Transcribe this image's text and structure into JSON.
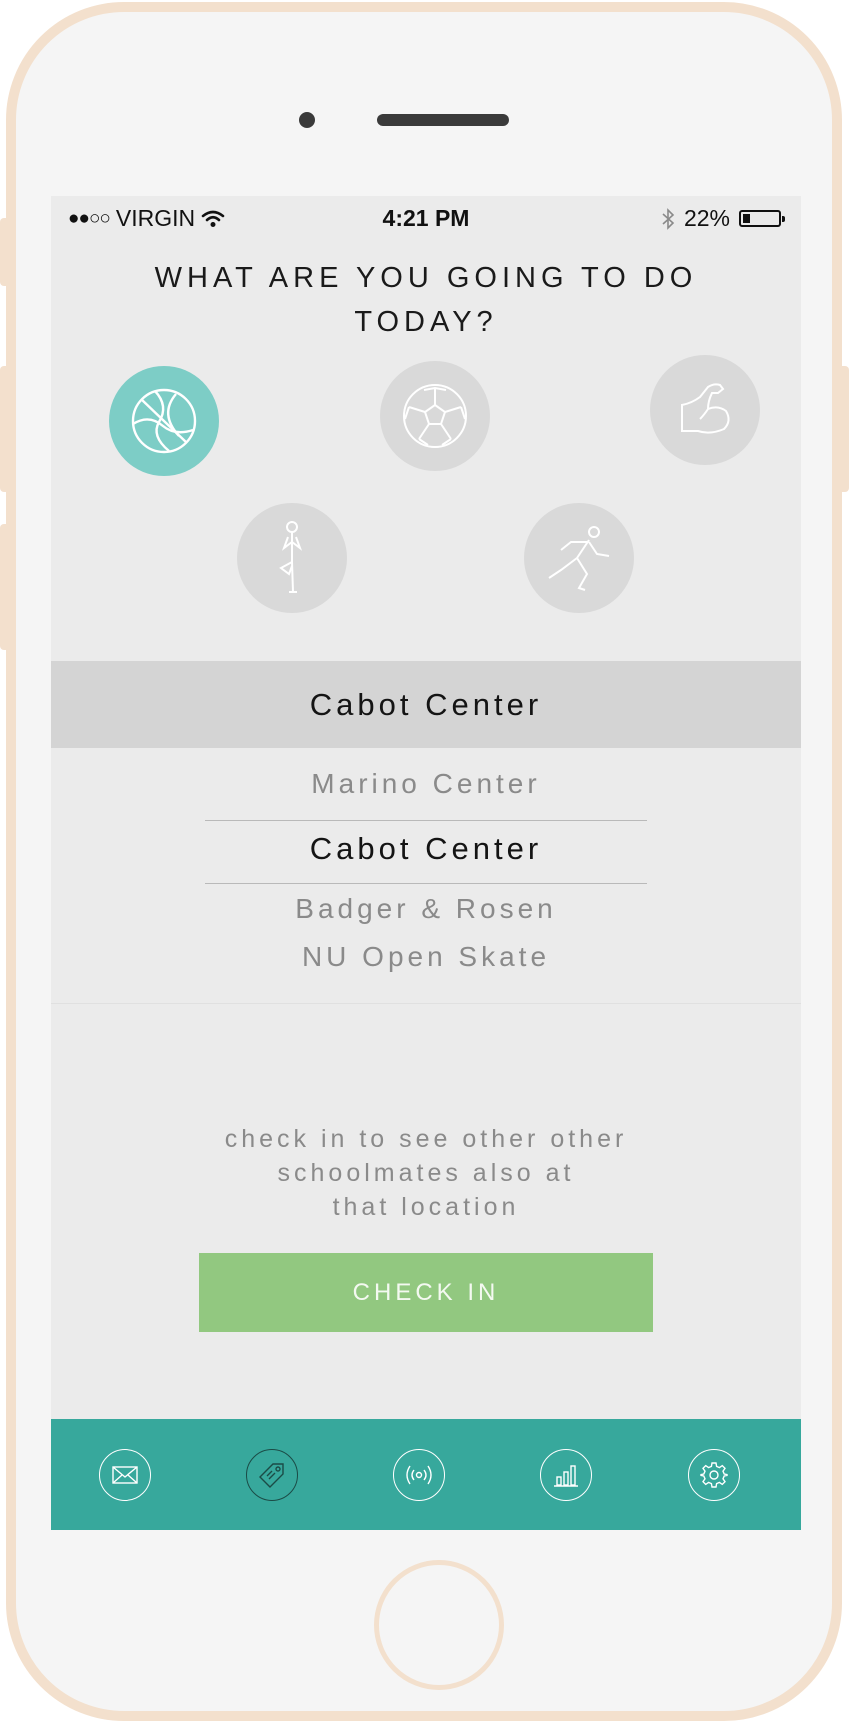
{
  "status_bar": {
    "signal": "●●○○",
    "carrier": "VIRGIN",
    "time": "4:21 PM",
    "battery_percent": "22%",
    "battery_level": 0.22
  },
  "question": {
    "line1": "WHAT ARE YOU GOING TO DO",
    "line2": "TODAY?"
  },
  "activities": [
    {
      "icon": "basketball-icon",
      "selected": true
    },
    {
      "icon": "soccer-ball-icon",
      "selected": false
    },
    {
      "icon": "flexed-arm-icon",
      "selected": false
    },
    {
      "icon": "yoga-icon",
      "selected": false
    },
    {
      "icon": "runner-icon",
      "selected": false
    }
  ],
  "selected_location": "Cabot Center",
  "locations": [
    "Marino Center",
    "Cabot Center",
    "Badger & Rosen",
    "NU Open Skate"
  ],
  "hint": {
    "line1": "check in to see other other",
    "line2": "schoolmates also at",
    "line3": "that location"
  },
  "check_in_label": "CHECK IN",
  "tabs": [
    {
      "icon": "mail-icon",
      "active": false
    },
    {
      "icon": "tag-icon",
      "active": true
    },
    {
      "icon": "broadcast-icon",
      "active": false
    },
    {
      "icon": "bar-chart-icon",
      "active": false
    },
    {
      "icon": "gear-icon",
      "active": false
    }
  ],
  "colors": {
    "accent_teal": "#37a89c",
    "selected_activity": "#7dcdc6",
    "check_in_green": "#92c880",
    "phone_frame": "#f3e0cd"
  }
}
